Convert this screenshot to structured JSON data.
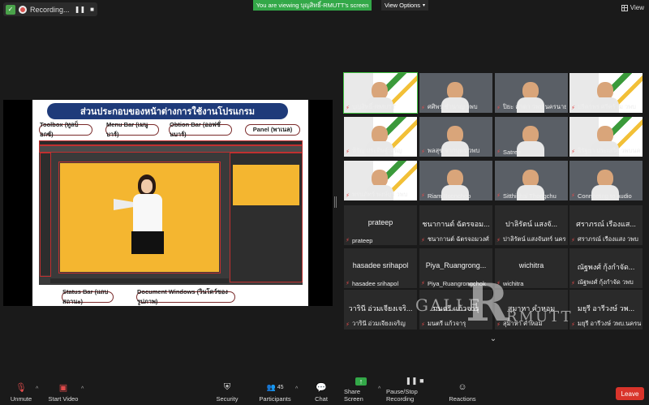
{
  "topbar": {
    "recording_label": "Recording...",
    "viewing_banner": "You are viewing บุญสิทธิ์-RMUTT's screen",
    "view_options": "View Options",
    "view_label": "View"
  },
  "slide": {
    "title": "ส่วนประกอบของหน้าต่างการใช้งานโปรแกรม",
    "labels": {
      "toolbox": "Toolbox (ทูลบ็อกซ์)",
      "menubar": "Menu Bar (เมนูบาร์)",
      "optionbar": "Obtion Bar (ออฟชั่นบาร์)",
      "panel": "Panel (พาเนล)",
      "statusbar": "Status Bar (แถบสถานะ)",
      "docwindow": "Document Windows (วินโดว์ของรูปภาพ)"
    }
  },
  "participants": [
    {
      "name": "บุญสิทธิ์-RMUTT",
      "kind": "banner",
      "active": true
    },
    {
      "name": "ศศิพร ชำนาญ วพบ",
      "kind": "photo"
    },
    {
      "name": "ปิยะ คำตา วพบ.นครนายก",
      "kind": "photo"
    },
    {
      "name": "ปรีดาพร ศรีคร้าม วพบ",
      "kind": "banner"
    },
    {
      "name": "หิรัญ ประดิษฐ์เจริญ",
      "kind": "banner"
    },
    {
      "name": "พลสุข จากบุตร วพบ",
      "kind": "photo"
    },
    {
      "name": "Satree",
      "kind": "photo"
    },
    {
      "name": "จิรัฐยา ประเสริฐ วพบนครนายก",
      "kind": "banner"
    },
    {
      "name": "พรนภัทร์ พงษ์บุรี วพบ",
      "kind": "banner"
    },
    {
      "name": "Riam Boonchoo",
      "kind": "photo"
    },
    {
      "name": "Sitthichai Thongchu",
      "kind": "photo"
    },
    {
      "name": "Connecting to audio",
      "kind": "photo"
    },
    {
      "name": "prateep",
      "big": "prateep",
      "kind": "text"
    },
    {
      "name": "ชนากานต์ ฉัตรจอมวงศ์ วพบ",
      "big": "ชนากานต์ ฉัตรจอม...",
      "kind": "text"
    },
    {
      "name": "ปาลิรัตน์ แสงจันทร์ นครนายก",
      "big": "ปาลิรัตน์ แสงจั...",
      "kind": "text"
    },
    {
      "name": "ศราภรณ์ เรืองแสง วพบ",
      "big": "ศราภรณ์ เรืองแส...",
      "kind": "text"
    },
    {
      "name": "hasadee srihapol",
      "big": "hasadee srihapol",
      "kind": "text"
    },
    {
      "name": "Piya_Ruangrongchok",
      "big": "Piya_Ruangrong...",
      "kind": "text"
    },
    {
      "name": "wichitra",
      "big": "wichitra",
      "kind": "text"
    },
    {
      "name": "ณัฐพงศ์ กุ้งกำจัด วพบ",
      "big": "ณัฐพงศ์ กุ้งกำจัด...",
      "kind": "text"
    },
    {
      "name": "วารินี อ่วมเจียงเจริญ",
      "big": "วารินี อ่วมเจียงเจริ...",
      "kind": "text"
    },
    {
      "name": "มนตรี แก้วจารุ",
      "big": "มนตรี แก้วจารุ",
      "kind": "text"
    },
    {
      "name": "สุมาหา คำหอม",
      "big": "สุมาหา คำหอม",
      "kind": "text"
    },
    {
      "name": "มยุรี อารีวงษ์ วพบ.นครนายก",
      "big": "มยุรี อารีวงษ์ วพ...",
      "kind": "text"
    }
  ],
  "watermark": {
    "gallery": "GALLE",
    "letter": "R",
    "suffix": "RMUTT"
  },
  "toolbar": {
    "unmute": "Unmute",
    "start_video": "Start Video",
    "security": "Security",
    "participants": "Participants",
    "participants_count": "45",
    "chat": "Chat",
    "share_screen": "Share Screen",
    "recording": "Pause/Stop Recording",
    "reactions": "Reactions",
    "leave": "Leave"
  },
  "colors": {
    "accent_green": "#33a848",
    "leave_red": "#d9342b",
    "slide_title_bg": "#1f3b7a"
  }
}
